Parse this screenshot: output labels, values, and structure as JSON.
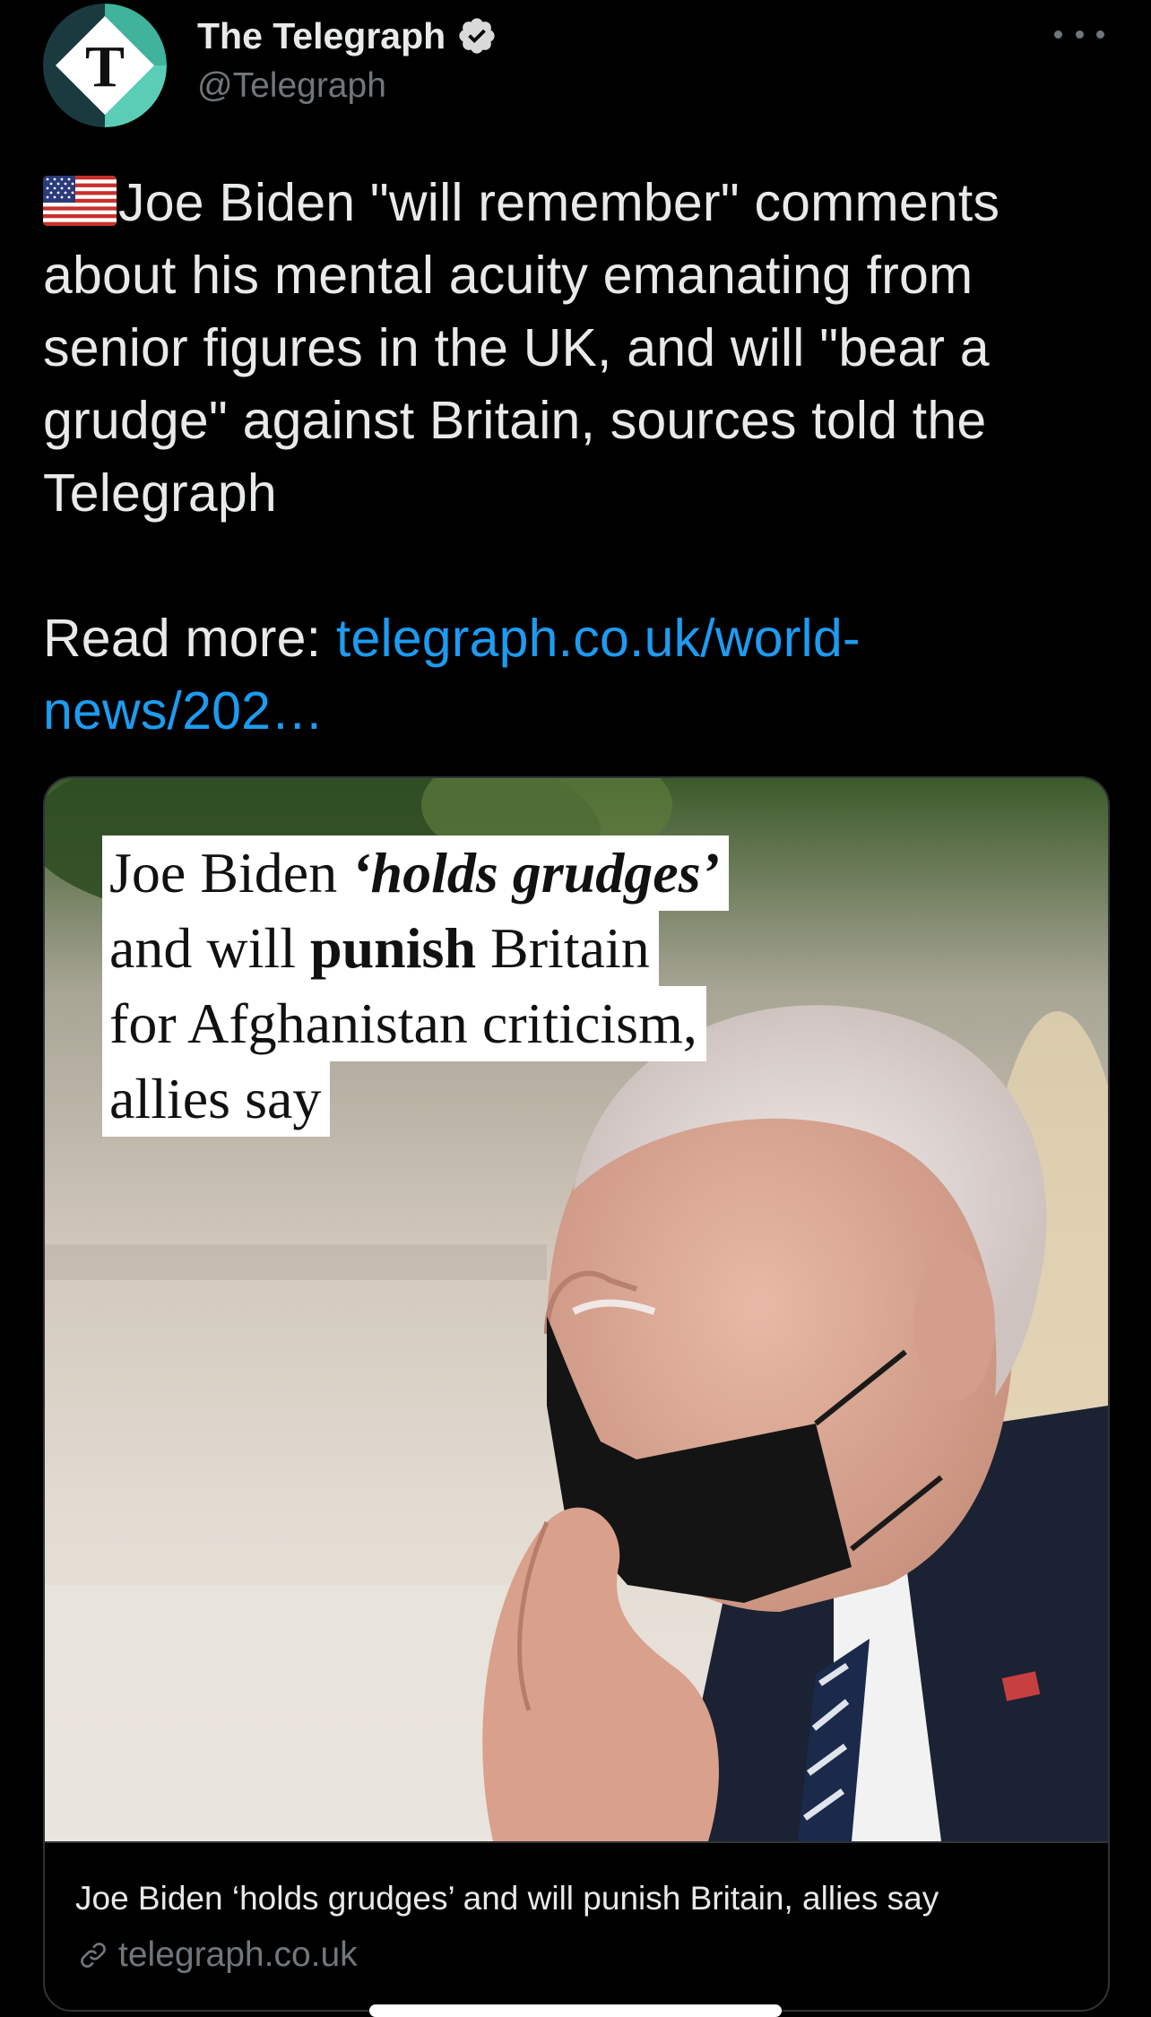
{
  "author": {
    "display_name": "The Telegraph",
    "handle": "@Telegraph",
    "verified": true,
    "avatar_icon": "telegraph-t-logo",
    "avatar_logo_letter": "T"
  },
  "menu": {
    "more_icon": "more-horizontal-icon"
  },
  "tweet": {
    "flag_icon": "us-flag-emoji",
    "text_main": "Joe Biden \"will remember\" comments about his mental acuity emanating from senior figures in the UK, and will \"bear a grudge\" against Britain, sources told the Telegraph",
    "read_more_label": "Read more: ",
    "link_text": "telegraph.co.uk/world-news/202…"
  },
  "card": {
    "image_headline": {
      "line1_prefix": "Joe Biden ",
      "line1_italic": "‘holds grudges’",
      "line2_prefix": "and will ",
      "line2_bold": "punish",
      "line2_suffix": " Britain",
      "line3": "for Afghanistan criticism,",
      "line4": "allies say"
    },
    "title": "Joe Biden ‘holds grudges’ and will punish Britain, allies say",
    "domain": "telegraph.co.uk",
    "link_icon": "link-icon"
  },
  "colors": {
    "background": "#000000",
    "text_primary": "#e7e9ea",
    "text_secondary": "#71767b",
    "link": "#1d9bf0",
    "border": "#2f3336",
    "telegraph_teal": "#52c9b0",
    "verified_badge": "#d9d9d9"
  }
}
